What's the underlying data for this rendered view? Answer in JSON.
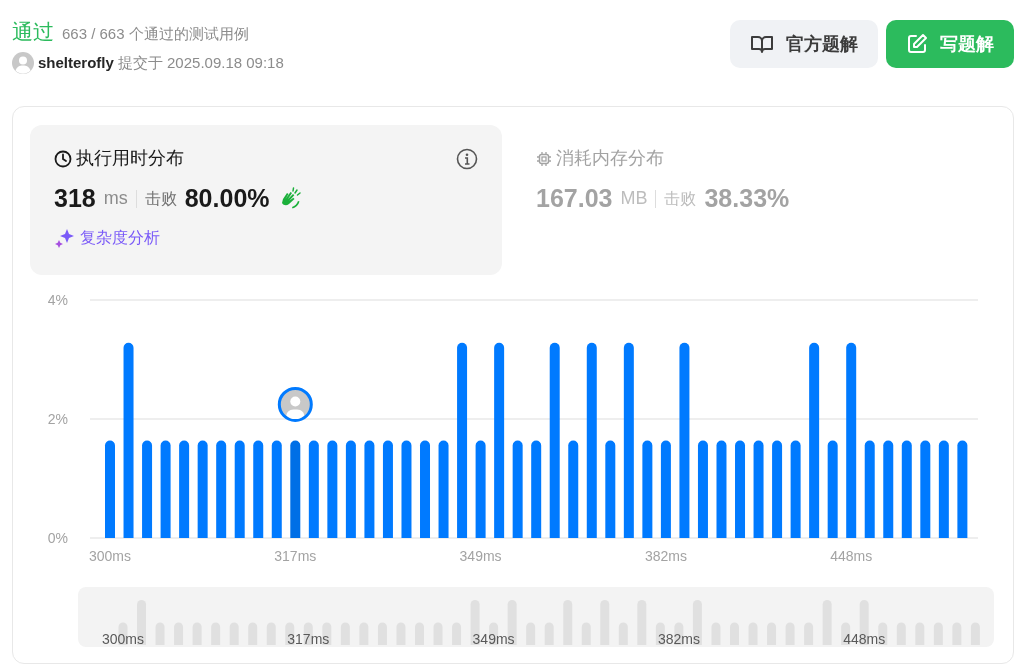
{
  "result": {
    "status": "通过",
    "cases": "663 / 663 个通过的测试用例"
  },
  "submission": {
    "user": "shelterofly",
    "submitted": "提交于 2025.09.18 09:18"
  },
  "buttons": [
    {
      "kind": "official",
      "label": "官方题解"
    },
    {
      "kind": "write",
      "label": "写题解"
    }
  ],
  "stats": [
    {
      "kind": "runtime",
      "title": "执行用时分布",
      "value": "318",
      "unit": "ms",
      "beats_label": "击败",
      "beats": "80.00%",
      "selected": true,
      "link": "复杂度分析"
    },
    {
      "kind": "memory",
      "title": "消耗内存分布",
      "value": "167.03",
      "unit": "MB",
      "beats_label": "击败",
      "beats": "38.33%",
      "selected": false
    }
  ],
  "distribution": {
    "chart_data": {
      "type": "bar",
      "categories": [
        "300ms",
        null,
        null,
        null,
        null,
        null,
        null,
        null,
        null,
        null,
        "317ms",
        null,
        null,
        null,
        null,
        null,
        null,
        null,
        null,
        null,
        "349ms",
        null,
        null,
        null,
        null,
        null,
        null,
        null,
        null,
        null,
        "382ms",
        null,
        null,
        null,
        null,
        null,
        null,
        null,
        null,
        null,
        "448ms",
        null,
        null,
        null,
        null,
        null,
        null
      ],
      "values": [
        1.64,
        3.28,
        1.64,
        1.64,
        1.64,
        1.64,
        1.64,
        1.64,
        1.64,
        1.64,
        1.64,
        1.64,
        1.64,
        1.64,
        1.64,
        1.64,
        1.64,
        1.64,
        1.64,
        3.28,
        1.64,
        3.28,
        1.64,
        1.64,
        3.28,
        1.64,
        3.28,
        1.64,
        3.28,
        1.64,
        1.64,
        3.28,
        1.64,
        1.64,
        1.64,
        1.64,
        1.64,
        1.64,
        3.28,
        1.64,
        3.28,
        1.64,
        1.64,
        1.64,
        1.64,
        1.64,
        1.64
      ],
      "ylim": [
        0,
        4
      ],
      "yticks": [
        {
          "value": 0,
          "label": "0%"
        },
        {
          "value": 2,
          "label": "2%"
        },
        {
          "value": 4,
          "label": "4%"
        }
      ],
      "annotations": [
        {
          "x": "317ms"
        }
      ]
    },
    "navigator": {
      "labels": [
        "300ms",
        "317ms",
        "349ms",
        "382ms",
        "448ms"
      ]
    }
  }
}
